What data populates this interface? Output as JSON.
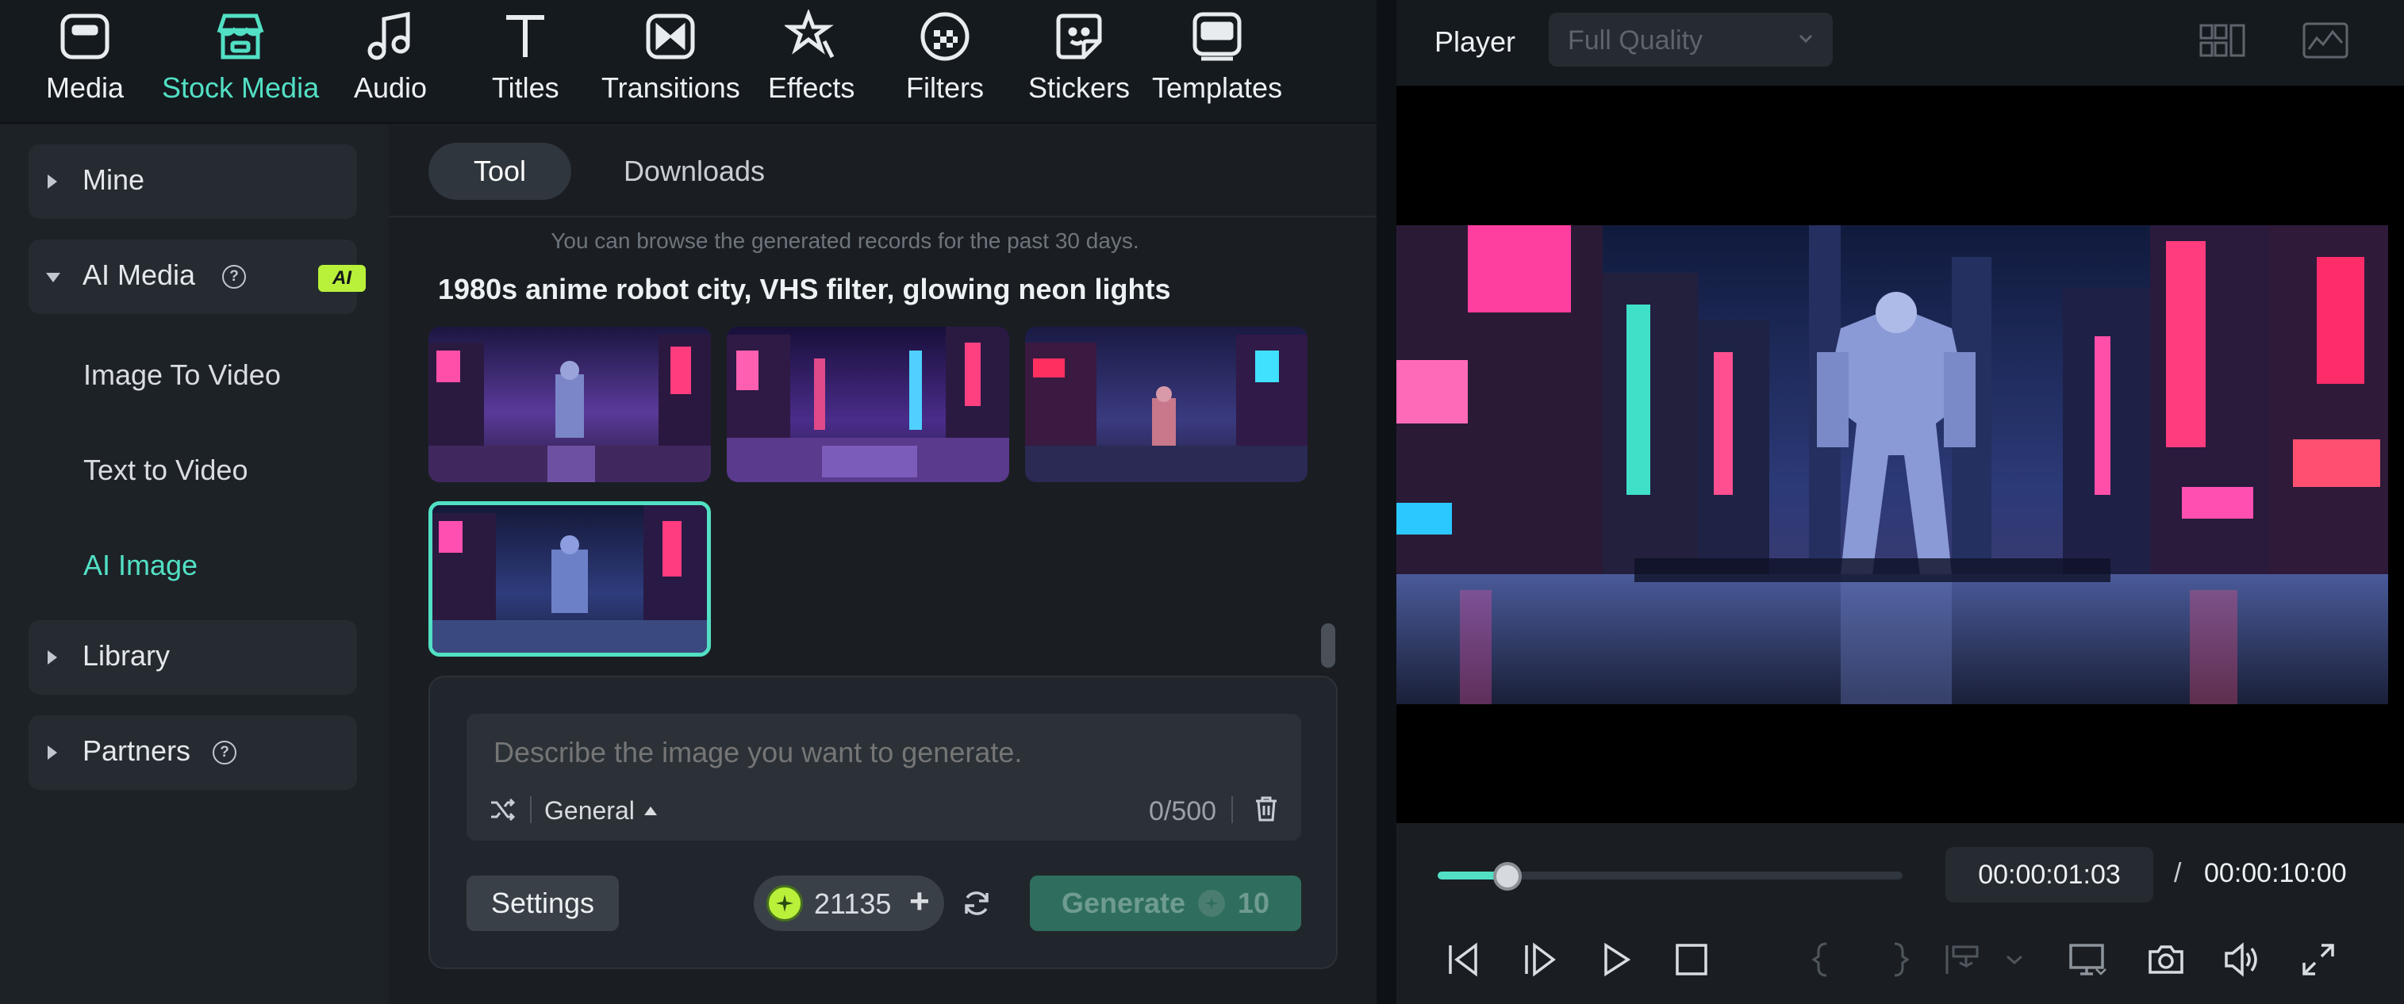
{
  "toolbar": {
    "tabs": [
      {
        "label": "Media",
        "icon": "media-icon"
      },
      {
        "label": "Stock Media",
        "icon": "stock-media-icon",
        "active": true
      },
      {
        "label": "Audio",
        "icon": "audio-icon"
      },
      {
        "label": "Titles",
        "icon": "titles-icon"
      },
      {
        "label": "Transitions",
        "icon": "transitions-icon"
      },
      {
        "label": "Effects",
        "icon": "effects-icon"
      },
      {
        "label": "Filters",
        "icon": "filters-icon"
      },
      {
        "label": "Stickers",
        "icon": "stickers-icon"
      },
      {
        "label": "Templates",
        "icon": "templates-icon"
      }
    ]
  },
  "sidebar": {
    "mine": "Mine",
    "ai_media": "AI Media",
    "ai_badge": "AI",
    "help_glyph": "?",
    "items": [
      "Image To Video",
      "Text to Video",
      "AI Image"
    ],
    "active_item": "AI Image",
    "library": "Library",
    "partners": "Partners"
  },
  "center": {
    "tabs": {
      "tool": "Tool",
      "downloads": "Downloads"
    },
    "records_note": "You can browse the generated records for the past 30 days.",
    "prompt_title": "1980s anime robot city, VHS filter, glowing neon lights",
    "selected_thumbnail": 4
  },
  "generator": {
    "placeholder": "Describe the image you want to generate.",
    "style": "General",
    "char_count": "0/500",
    "settings_label": "Settings",
    "credits": "21135",
    "credits_plus": "+",
    "generate_label": "Generate",
    "generate_cost": "10"
  },
  "player": {
    "title": "Player",
    "quality": "Full Quality",
    "current_time": "00:00:01:03",
    "separator": "/",
    "total_time": "00:00:10:00",
    "progress_fraction": 0.15
  },
  "colors": {
    "accent": "#52e0c4",
    "ai_badge": "#b8f03a",
    "generate_button": "#2f6e5f"
  }
}
